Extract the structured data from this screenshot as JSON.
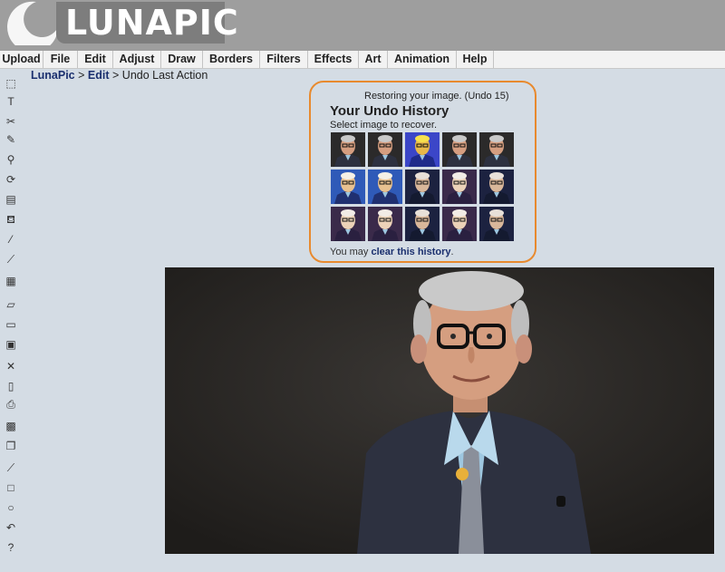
{
  "app": {
    "logo_text": "LUNAPIC"
  },
  "menu": [
    {
      "label": "Upload"
    },
    {
      "label": "File"
    },
    {
      "label": "Edit"
    },
    {
      "label": "Adjust"
    },
    {
      "label": "Draw"
    },
    {
      "label": "Borders"
    },
    {
      "label": "Filters"
    },
    {
      "label": "Effects"
    },
    {
      "label": "Art"
    },
    {
      "label": "Animation"
    },
    {
      "label": "Help"
    }
  ],
  "breadcrumb": {
    "items": [
      "LunaPic",
      "Edit"
    ],
    "separator": ">",
    "current": "Undo Last Action"
  },
  "toolbar": {
    "icons": [
      {
        "name": "marquee-select-icon",
        "glyph": "⬚"
      },
      {
        "name": "text-tool-icon",
        "glyph": "T"
      },
      {
        "name": "scissors-icon",
        "glyph": "✂"
      },
      {
        "name": "pencil-icon",
        "glyph": "✎"
      },
      {
        "name": "zoom-icon",
        "glyph": "⚲"
      },
      {
        "name": "rotate-icon",
        "glyph": "⟳"
      },
      {
        "name": "gradient-icon",
        "glyph": "▤"
      },
      {
        "name": "paint-bucket-icon",
        "glyph": "⛾"
      },
      {
        "name": "eyedropper-icon",
        "glyph": "⁄"
      },
      {
        "name": "brush-icon",
        "glyph": "⟋"
      },
      {
        "name": "layers-icon",
        "glyph": "▦"
      },
      {
        "name": "eraser-icon",
        "glyph": "▱"
      },
      {
        "name": "open-folder-icon",
        "glyph": "▭"
      },
      {
        "name": "save-icon",
        "glyph": "▣"
      },
      {
        "name": "delete-icon",
        "glyph": "✕"
      },
      {
        "name": "new-document-icon",
        "glyph": "▯"
      },
      {
        "name": "print-icon",
        "glyph": "⎙"
      },
      {
        "name": "stack-icon",
        "glyph": "▩"
      },
      {
        "name": "copy-icon",
        "glyph": "❐"
      },
      {
        "name": "line-icon",
        "glyph": "⟋"
      },
      {
        "name": "rectangle-icon",
        "glyph": "□"
      },
      {
        "name": "circle-icon",
        "glyph": "○"
      },
      {
        "name": "undo-icon",
        "glyph": "↶"
      },
      {
        "name": "help-icon",
        "glyph": "?"
      }
    ]
  },
  "undo_panel": {
    "restoring_text": "Restoring your image. (Undo 15)",
    "title": "Your Undo History",
    "subtitle": "Select image to recover.",
    "clear_prefix": "You may ",
    "clear_link": "clear this history",
    "clear_suffix": ".",
    "thumbnail_styles": [
      "photo",
      "photo",
      "pop-art",
      "photo",
      "photo",
      "comic",
      "comic",
      "comic-dark",
      "comic-pale",
      "comic-dark",
      "comic-pale",
      "comic-pale",
      "comic-dark",
      "comic-pale",
      "comic-dark"
    ]
  },
  "colors": {
    "header_bg": "#9e9e9e",
    "page_bg": "#d4dce4",
    "link": "#1a2f6e",
    "undo_border": "#e88a2e"
  }
}
